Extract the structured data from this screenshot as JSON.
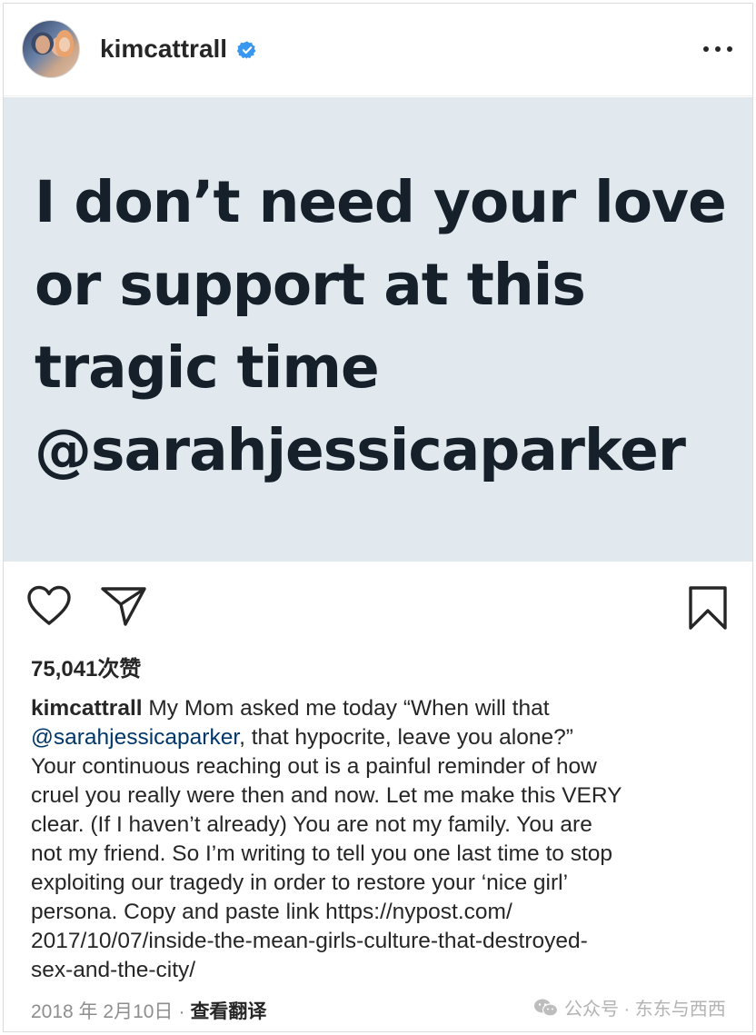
{
  "post": {
    "username": "kimcattrall",
    "verified": true,
    "menu_icon": "more-horizontal-icon",
    "image_quote_lines": [
      "I don’t need your love",
      "or support at this",
      "tragic time",
      "@sarahjessicaparker"
    ],
    "likes": "75,041次赞",
    "caption": {
      "username": "kimcattrall",
      "lines": [
        " My Mom asked me today “When will that",
        "@sarahjessicaparker",
        ", that hypocrite, leave you alone?”",
        "Your continuous reaching out is a painful reminder of how",
        "cruel you really were then and now. Let me make this VERY",
        "clear. (If I haven’t already) You are not my family. You are",
        "not my friend. So I’m writing to tell you one last time to stop",
        "exploiting our tragedy in order to restore your ‘nice girl’",
        "persona. Copy and paste link https://nypost.com/",
        "2017/10/07/inside-the-mean-girls-culture-that-destroyed-",
        "sex-and-the-city/"
      ]
    },
    "date": "2018 年 2月10日",
    "separator": "·",
    "translate": "查看翻译"
  },
  "watermark": "公众号 · 东东与西西",
  "colors": {
    "image_bg": "#e2e9ee",
    "quote_text": "#15202b",
    "mention": "#00376b",
    "verified": "#3897f0",
    "muted": "#8e8e8e"
  },
  "icons": [
    "heart-icon",
    "send-icon",
    "bookmark-icon",
    "verified-badge-icon",
    "wechat-icon"
  ]
}
